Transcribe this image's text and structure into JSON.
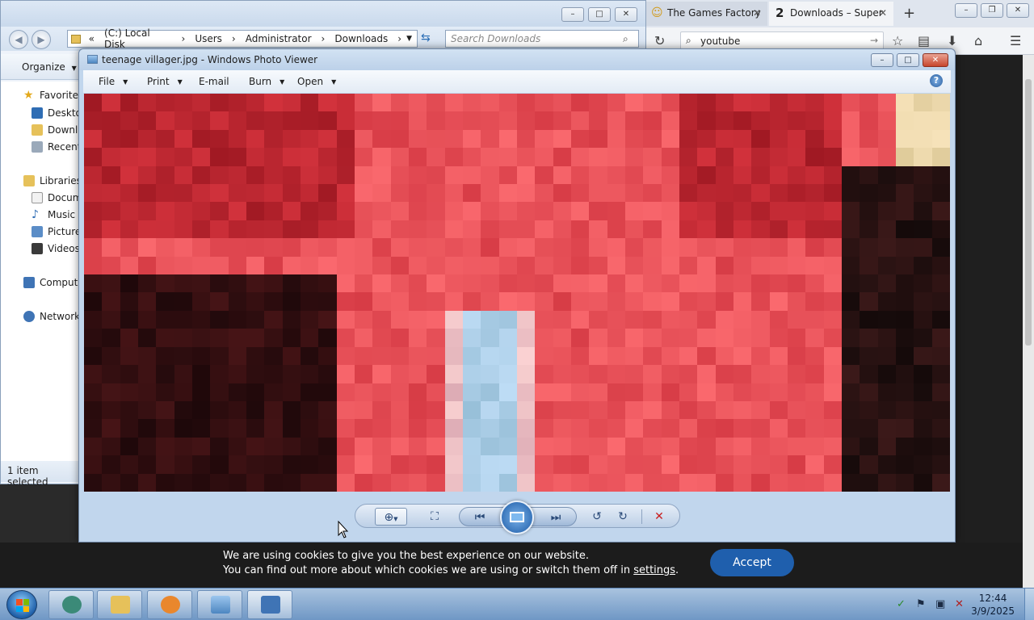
{
  "explorer": {
    "address": {
      "prefix": "«",
      "segments": [
        "(C:) Local Disk",
        "Users",
        "Administrator",
        "Downloads"
      ]
    },
    "search_placeholder": "Search Downloads",
    "organize_label": "Organize",
    "nav": {
      "favorites": "Favorites",
      "desktop": "Desktop",
      "downloads": "Downloads",
      "recent": "Recent Places",
      "libraries": "Libraries",
      "documents": "Documents",
      "music": "Music",
      "pictures": "Pictures",
      "videos": "Videos",
      "computer": "Computer",
      "network": "Network"
    },
    "status": "1 item selected"
  },
  "browser": {
    "tabs": [
      {
        "label": "The Games Factory"
      },
      {
        "label": "Downloads – Super"
      }
    ],
    "new_tab": "+",
    "url": "youtube"
  },
  "viewer": {
    "title": "teenage villager.jpg - Windows Photo Viewer",
    "menu": {
      "file": "File",
      "print": "Print",
      "email": "E-mail",
      "burn": "Burn",
      "open": "Open"
    },
    "help": "?"
  },
  "cookie": {
    "line1": "We are using cookies to give you the best experience on our website.",
    "line2_prefix": "You can find out more about which cookies we are using or switch them off in ",
    "line2_link": "settings",
    "line2_suffix": ".",
    "accept": "Accept"
  },
  "taskbar": {
    "time": "12:44",
    "date": "3/9/2025"
  }
}
